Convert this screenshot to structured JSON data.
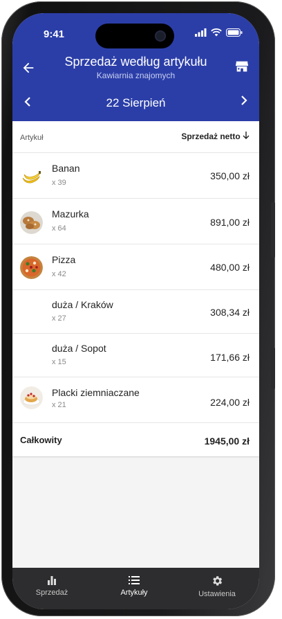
{
  "status_bar": {
    "time": "9:41"
  },
  "header": {
    "title": "Sprzedaż według artykułu",
    "subtitle": "Kawiarnia znajomych",
    "date": "22 Sierpień",
    "back_icon": "arrow-left-icon",
    "store_icon": "store-icon"
  },
  "table": {
    "col_item": "Artykuł",
    "col_sales": "Sprzedaż netto",
    "rows": [
      {
        "name": "Banan",
        "qty": "x 39",
        "amount": "350,00 zł",
        "icon": "banana-icon"
      },
      {
        "name": "Mazurka",
        "qty": "x 64",
        "amount": "891,00 zł",
        "icon": "pastry-icon"
      },
      {
        "name": "Pizza",
        "qty": "x 42",
        "amount": "480,00 zł",
        "icon": "pizza-icon"
      },
      {
        "name": "duża / Kraków",
        "qty": "x 27",
        "amount": "308,34 zł"
      },
      {
        "name": "duża / Sopot",
        "qty": "x 15",
        "amount": "171,66 zł"
      },
      {
        "name": "Placki ziemniaczane",
        "qty": "x 21",
        "amount": "224,00 zł",
        "icon": "pancakes-icon"
      }
    ],
    "total_label": "Całkowity",
    "total_amount": "1945,00 zł"
  },
  "nav": {
    "sales": "Sprzedaż",
    "items": "Artykuły",
    "settings": "Ustawienia"
  },
  "colors": {
    "primary": "#2b3ea8",
    "nav_bg": "#2d2d2f"
  }
}
